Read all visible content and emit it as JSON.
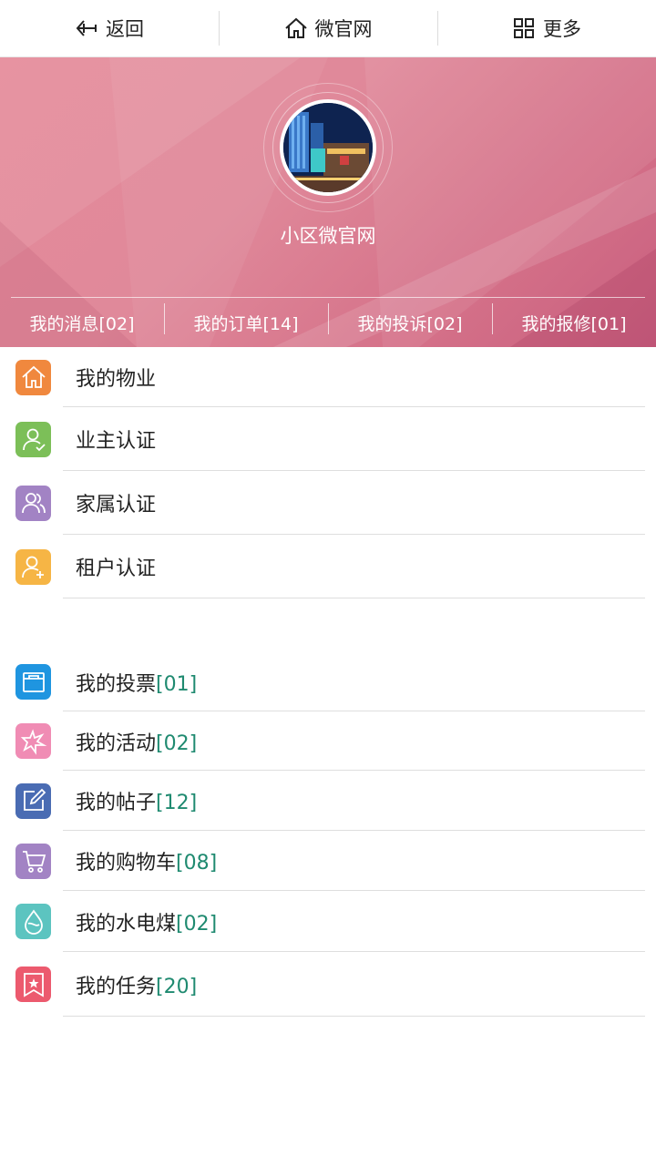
{
  "topbar": {
    "back": {
      "label": "返回",
      "icon": "back-arrow-icon"
    },
    "home": {
      "label": "微官网",
      "icon": "home-icon"
    },
    "more": {
      "label": "更多",
      "icon": "grid-icon"
    }
  },
  "profile": {
    "site_name": "小区微官网"
  },
  "stats": [
    {
      "label": "我的消息",
      "count": "[02]"
    },
    {
      "label": "我的订单",
      "count": "[14]"
    },
    {
      "label": "我的投诉",
      "count": "[02]"
    },
    {
      "label": "我的报修",
      "count": "[01]"
    }
  ],
  "menu_property": [
    {
      "label": "我的物业",
      "icon": "house-icon",
      "color": "#f0883e"
    },
    {
      "label": "业主认证",
      "icon": "user-check-icon",
      "color": "#7cbf58"
    },
    {
      "label": "家属认证",
      "icon": "users-icon",
      "color": "#a283c4"
    },
    {
      "label": "租户认证",
      "icon": "user-plus-icon",
      "color": "#f6b545"
    }
  ],
  "menu_personal": [
    {
      "label": "我的投票",
      "count": "[01]",
      "icon": "ballot-box-icon",
      "color": "#1f95e0"
    },
    {
      "label": "我的活动",
      "count": "[02]",
      "icon": "star-burst-icon",
      "color": "#f08cb4"
    },
    {
      "label": "我的帖子",
      "count": "[12]",
      "icon": "edit-icon",
      "color": "#4a6cb3"
    },
    {
      "label": "我的购物车",
      "count": "[08]",
      "icon": "cart-icon",
      "color": "#a283c4"
    },
    {
      "label": "我的水电煤",
      "count": "[02]",
      "icon": "water-drop-icon",
      "color": "#5cc4c0"
    },
    {
      "label": "我的任务",
      "count": "[20]",
      "icon": "bookmark-star-icon",
      "color": "#ec5a6e"
    }
  ]
}
